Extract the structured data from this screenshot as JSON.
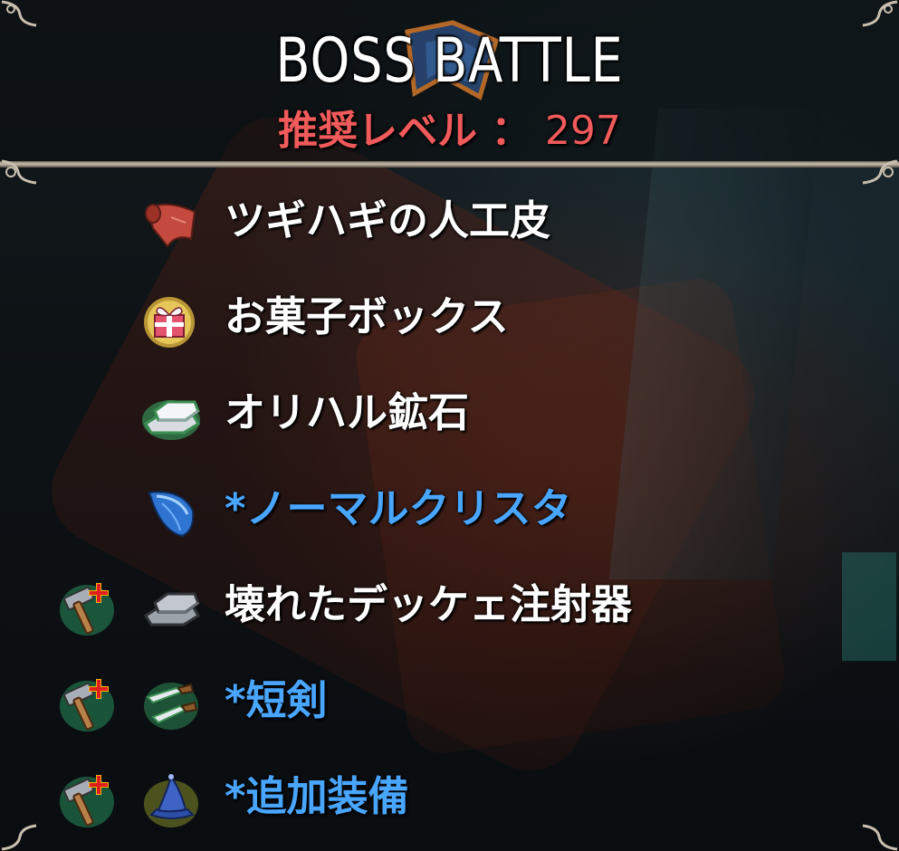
{
  "header": {
    "title": "BOSS BATTLE",
    "level_label": "推奨レベル ：",
    "level_value": "297"
  },
  "items": [
    {
      "label": "ツギハギの人工皮",
      "icon": "patched-leather-icon",
      "color": "#ffffff",
      "craftable": false
    },
    {
      "label": "お菓子ボックス",
      "icon": "gift-box-icon",
      "color": "#ffffff",
      "craftable": false
    },
    {
      "label": "オリハル鉱石",
      "icon": "silver-ingot-icon",
      "color": "#ffffff",
      "craftable": false
    },
    {
      "label": "*ノーマルクリスタ",
      "icon": "blue-crystal-icon",
      "color": "#49a6ff",
      "craftable": false
    },
    {
      "label": "壊れたデッケェ注射器",
      "icon": "gray-ingot-icon",
      "color": "#ffffff",
      "craftable": true
    },
    {
      "label": "*短剣",
      "icon": "daggers-icon",
      "color": "#49a6ff",
      "craftable": true
    },
    {
      "label": "*追加装備",
      "icon": "wizard-hat-icon",
      "color": "#49a6ff",
      "craftable": true
    }
  ],
  "colors": {
    "title": "#ffffff",
    "level": "#f05a5a",
    "item_normal": "#ffffff",
    "item_blue": "#49a6ff"
  },
  "icons": {
    "craft": "hammer-plus-icon"
  }
}
